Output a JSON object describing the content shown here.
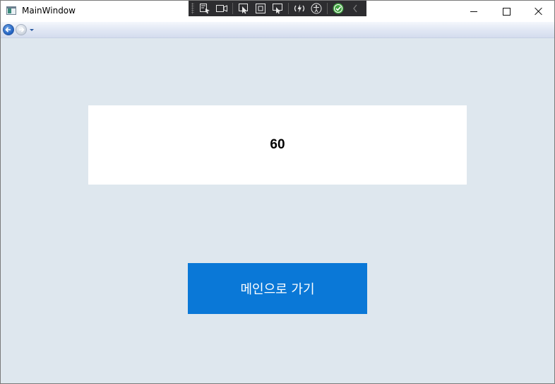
{
  "window": {
    "title": "MainWindow"
  },
  "debug_toolbar": {
    "icons": [
      "select-element-icon",
      "video-icon",
      "pointer-select-icon",
      "frame-icon",
      "display-layout-icon",
      "hot-reload-icon",
      "accessibility-icon",
      "check-icon",
      "collapse-icon"
    ]
  },
  "navigation": {
    "back_icon": "back-arrow-icon",
    "forward_icon": "forward-arrow-icon"
  },
  "content": {
    "value": "60",
    "button_label": "메인으로 가기"
  },
  "colors": {
    "background": "#dee7ee",
    "panel": "#ffffff",
    "button": "#0a78d7",
    "button_text": "#ffffff"
  }
}
